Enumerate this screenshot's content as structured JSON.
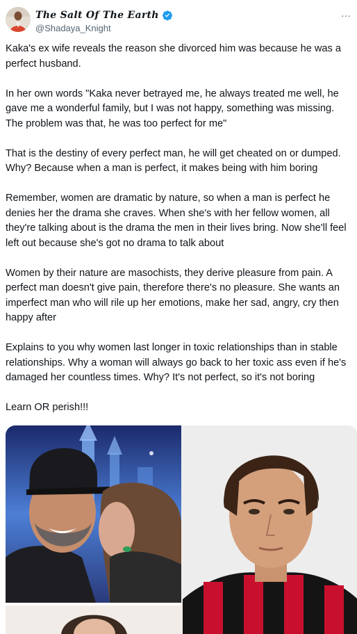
{
  "tweet": {
    "display_name": "The Salt Of The Earth",
    "handle": "@Shadaya_Knight",
    "more_label": "···",
    "paragraphs": [
      "Kaka's ex wife reveals the reason she divorced him was because he was a perfect husband.",
      "In her own words \"Kaka never betrayed me, he always treated me well, he gave me a wonderful family, but I was not happy, something was missing. The problem was that, he was too perfect for me\"",
      "That is the destiny of every perfect man, he will get cheated on or dumped. Why? Because when a man is perfect, it makes being with him boring",
      "Remember, women are dramatic by nature, so when a man is perfect he denies her the drama she craves. When she's with her fellow women, all they're talking about is the drama the men in their lives bring. Now she'll feel left out because she's got no drama to talk about",
      "Women by their nature are masochists, they derive pleasure from pain. A perfect man doesn't give pain, therefore there's no pleasure. She wants an imperfect man who will rile up her emotions, make her sad, angry, cry then happy after",
      "Explains to you why women last longer in toxic relationships than in stable relationships. Why a woman will always go back to her toxic ass even if he's damaged her countless times. Why? It's not perfect, so it's not boring",
      "Learn OR perish!!!"
    ]
  },
  "colors": {
    "text": "#0f1419",
    "secondary": "#536471",
    "verified": "#1d9bf0"
  },
  "icons": {
    "verified": "verified-badge-icon",
    "more": "more-options-icon"
  }
}
